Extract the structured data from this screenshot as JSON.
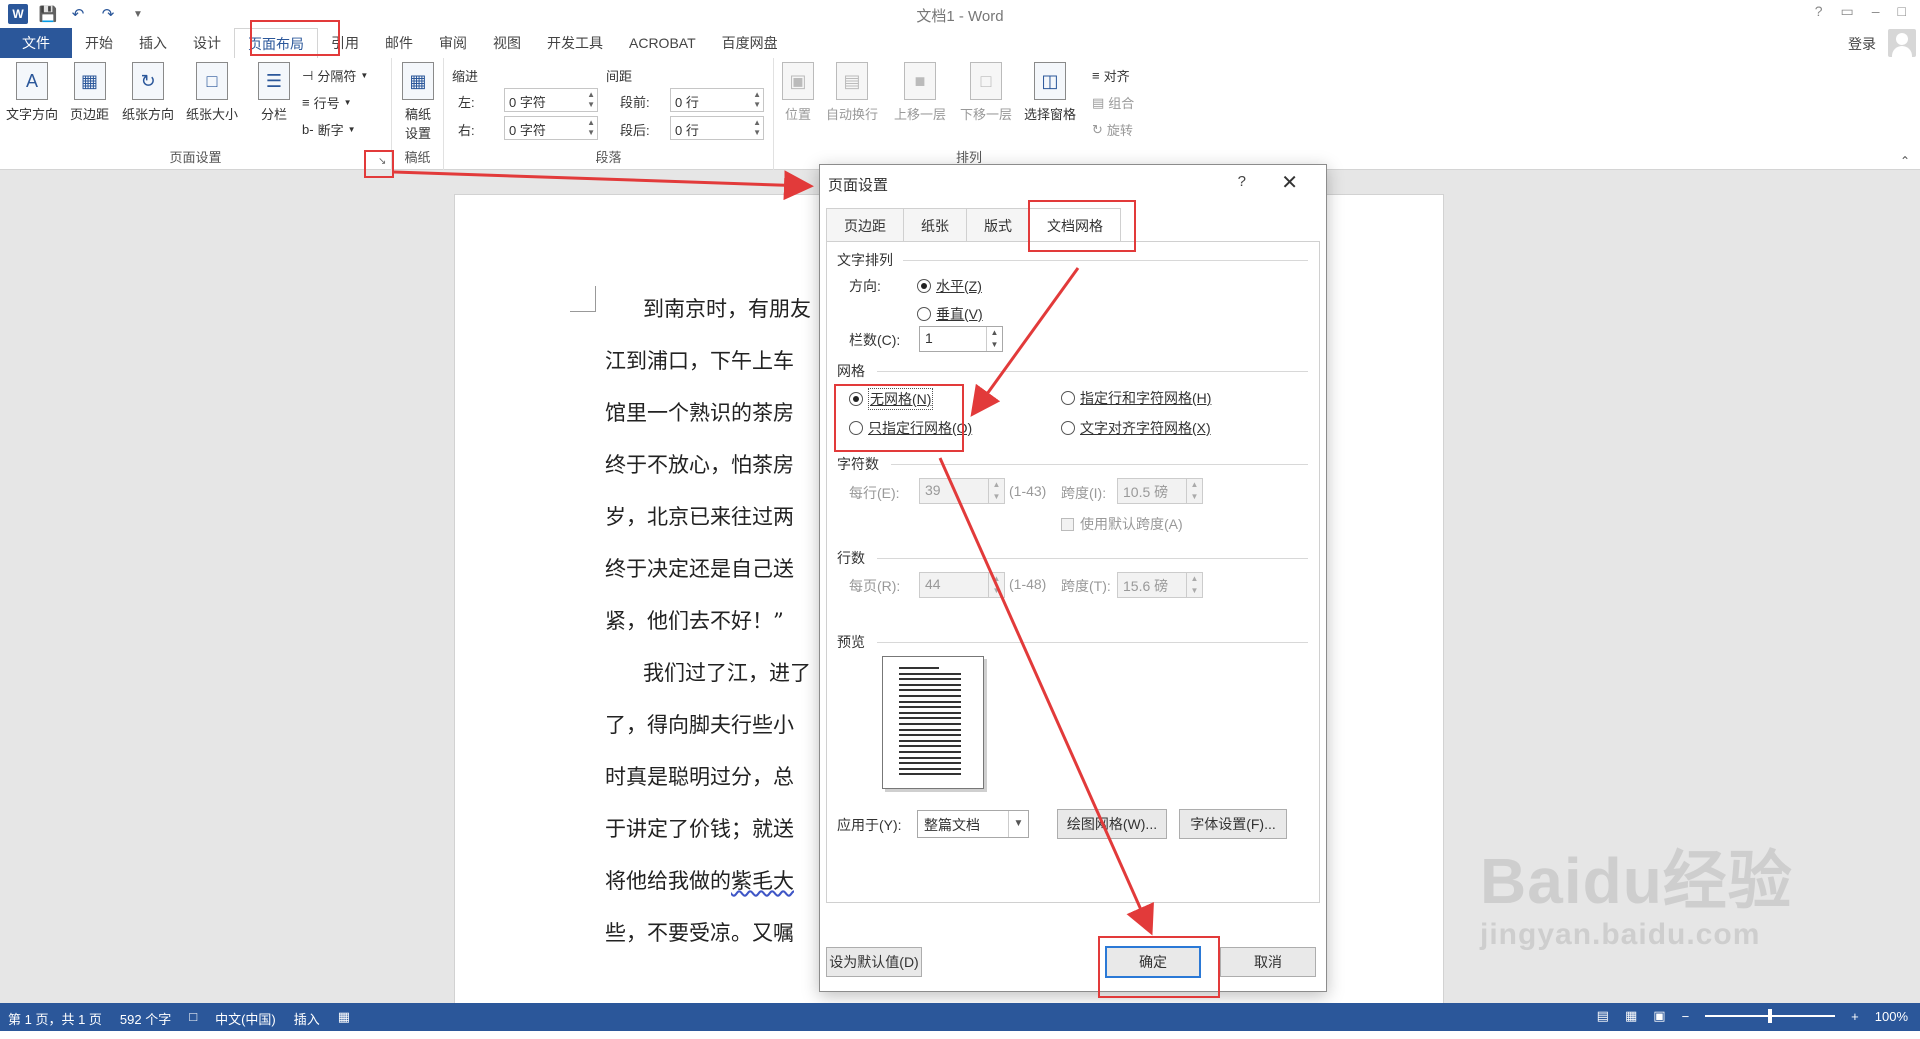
{
  "window": {
    "title": "文档1 - Word",
    "controls": [
      "?",
      "▭",
      "–",
      "□"
    ]
  },
  "ribbon_tabs": {
    "file": "文件",
    "tabs": [
      "开始",
      "插入",
      "设计",
      "页面布局",
      "引用",
      "邮件",
      "审阅",
      "视图",
      "开发工具",
      "ACROBAT",
      "百度网盘"
    ],
    "active": "页面布局",
    "login": "登录"
  },
  "ribbon": {
    "page_setup": {
      "label": "页面设置",
      "buttons": [
        "文字方向",
        "页边距",
        "纸张方向",
        "纸张大小",
        "分栏"
      ],
      "small": [
        "分隔符",
        "行号",
        "断字"
      ]
    },
    "draft": {
      "label": "稿纸",
      "button": "稿纸设置"
    },
    "paragraph": {
      "label": "段落",
      "indent_title": "缩进",
      "spacing_title": "间距",
      "left_label": "左:",
      "left_value": "0 字符",
      "right_label": "右:",
      "right_value": "0 字符",
      "before_label": "段前:",
      "before_value": "0 行",
      "after_label": "段后:",
      "after_value": "0 行"
    },
    "arrange": {
      "label": "排列",
      "buttons": [
        "位置",
        "自动换行",
        "上移一层",
        "下移一层",
        "选择窗格"
      ],
      "small": [
        "对齐",
        "组合",
        "旋转"
      ]
    }
  },
  "document": {
    "lines": [
      "到南京时，有朋友",
      "江到浦口，下午上车",
      "馆里一个熟识的茶房",
      "终于不放心，怕茶房",
      "岁，北京已来往过两",
      "终于决定还是自己送",
      "紧，他们去不好！”",
      "我们过了江，进了",
      "了，得向脚夫行些小",
      "时真是聪明过分，总",
      "于讲定了价钱；就送",
      "将他给我做的紫毛大",
      "些，不要受凉。又嘱"
    ],
    "squiggle_text": "紫毛大"
  },
  "statusbar": {
    "page": "第 1 页，共 1 页",
    "words": "592 个字",
    "language": "中文(中国)",
    "mode": "插入",
    "zoom": "100%",
    "zoom_level": 1.0
  },
  "dialog": {
    "title": "页面设置",
    "help": "?",
    "close": "✕",
    "tabs": [
      "页边距",
      "纸张",
      "版式",
      "文档网格"
    ],
    "active_tab": "文档网格",
    "text_flow": {
      "title": "文字排列",
      "direction_label": "方向:",
      "horizontal": "水平(Z)",
      "vertical": "垂直(V)",
      "columns_label": "栏数(C):",
      "columns_value": "1"
    },
    "grid": {
      "title": "网格",
      "no_grid": "无网格(N)",
      "line_and_char": "指定行和字符网格(H)",
      "lines_only": "只指定行网格(O)",
      "snap_chars": "文字对齐字符网格(X)",
      "selected": "无网格(N)"
    },
    "characters": {
      "title": "字符数",
      "per_line_label": "每行(E):",
      "per_line_value": "39",
      "per_line_range": "(1-43)",
      "pitch_label": "跨度(I):",
      "pitch_value": "10.5 磅",
      "default_pitch": "使用默认跨度(A)"
    },
    "lines": {
      "title": "行数",
      "per_page_label": "每页(R):",
      "per_page_value": "44",
      "per_page_range": "(1-48)",
      "pitch_label": "跨度(T):",
      "pitch_value": "15.6 磅"
    },
    "preview": {
      "title": "预览"
    },
    "apply_label": "应用于(Y):",
    "apply_value": "整篇文档",
    "draw_grid": "绘图网格(W)...",
    "font_settings": "字体设置(F)...",
    "set_default": "设为默认值(D)",
    "ok": "确定",
    "cancel": "取消"
  },
  "watermark": {
    "logo": "Baidu经验",
    "url": "jingyan.baidu.com"
  },
  "colors": {
    "accent": "#2b579a",
    "annotation": "#e23a3a"
  }
}
